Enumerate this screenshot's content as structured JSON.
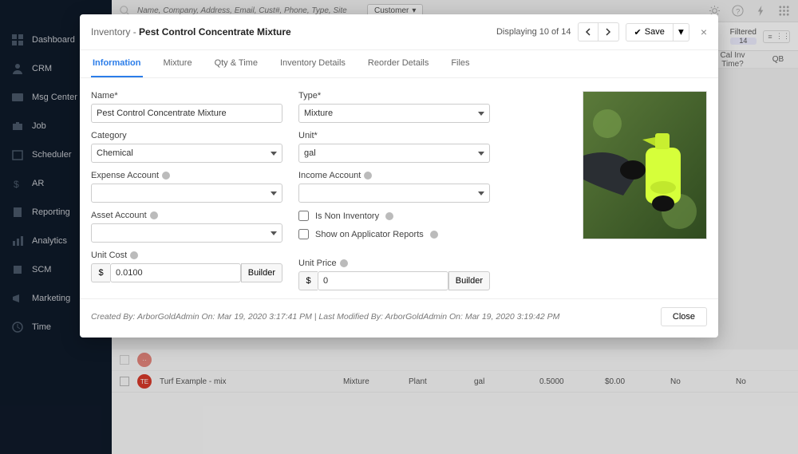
{
  "sidebar": {
    "items": [
      {
        "label": "Dashboard"
      },
      {
        "label": "CRM"
      },
      {
        "label": "Msg Center"
      },
      {
        "label": "Job"
      },
      {
        "label": "Scheduler"
      },
      {
        "label": "AR"
      },
      {
        "label": "Reporting"
      },
      {
        "label": "Analytics"
      },
      {
        "label": "SCM"
      },
      {
        "label": "Marketing"
      },
      {
        "label": "Time"
      }
    ]
  },
  "topbar": {
    "search_placeholder": "Name, Company, Address, Email, Cust#, Phone, Type, Site",
    "customer_btn": "Customer"
  },
  "subheader": {
    "filtered_label": "Filtered",
    "filtered_count": "14"
  },
  "colheaders": {
    "cal_inv_time": "Cal Inv Time?",
    "qb": "QB"
  },
  "rows": [
    {
      "badge": "TE",
      "name": "Turf Example - mix",
      "type": "Mixture",
      "kind": "Plant",
      "unit": "gal",
      "cost": "0.5000",
      "price": "$0.00",
      "cal": "No",
      "qb": "No"
    }
  ],
  "modal": {
    "breadcrumb": "Inventory - ",
    "title": "Pest Control Concentrate Mixture",
    "displaying": "Displaying 10 of 14",
    "save": "Save",
    "close_x": "×",
    "tabs": [
      "Information",
      "Mixture",
      "Qty & Time",
      "Inventory Details",
      "Reorder Details",
      "Files"
    ],
    "labels": {
      "name": "Name*",
      "category": "Category",
      "expense": "Expense Account",
      "asset": "Asset Account",
      "unit_cost": "Unit Cost",
      "type": "Type*",
      "unit": "Unit*",
      "income": "Income Account",
      "non_inv": "Is Non Inventory",
      "applicator": "Show on Applicator Reports",
      "unit_price": "Unit Price"
    },
    "values": {
      "name": "Pest Control Concentrate Mixture",
      "category": "Chemical",
      "type": "Mixture",
      "unit": "gal",
      "unit_cost": "0.0100",
      "unit_price": "0",
      "currency": "$",
      "builder": "Builder"
    },
    "footer": {
      "meta": "Created By:  ArborGoldAdmin  On: Mar 19, 2020 3:17:41 PM  |  Last Modified By:  ArborGoldAdmin  On: Mar 19, 2020 3:19:42 PM",
      "close": "Close"
    }
  }
}
